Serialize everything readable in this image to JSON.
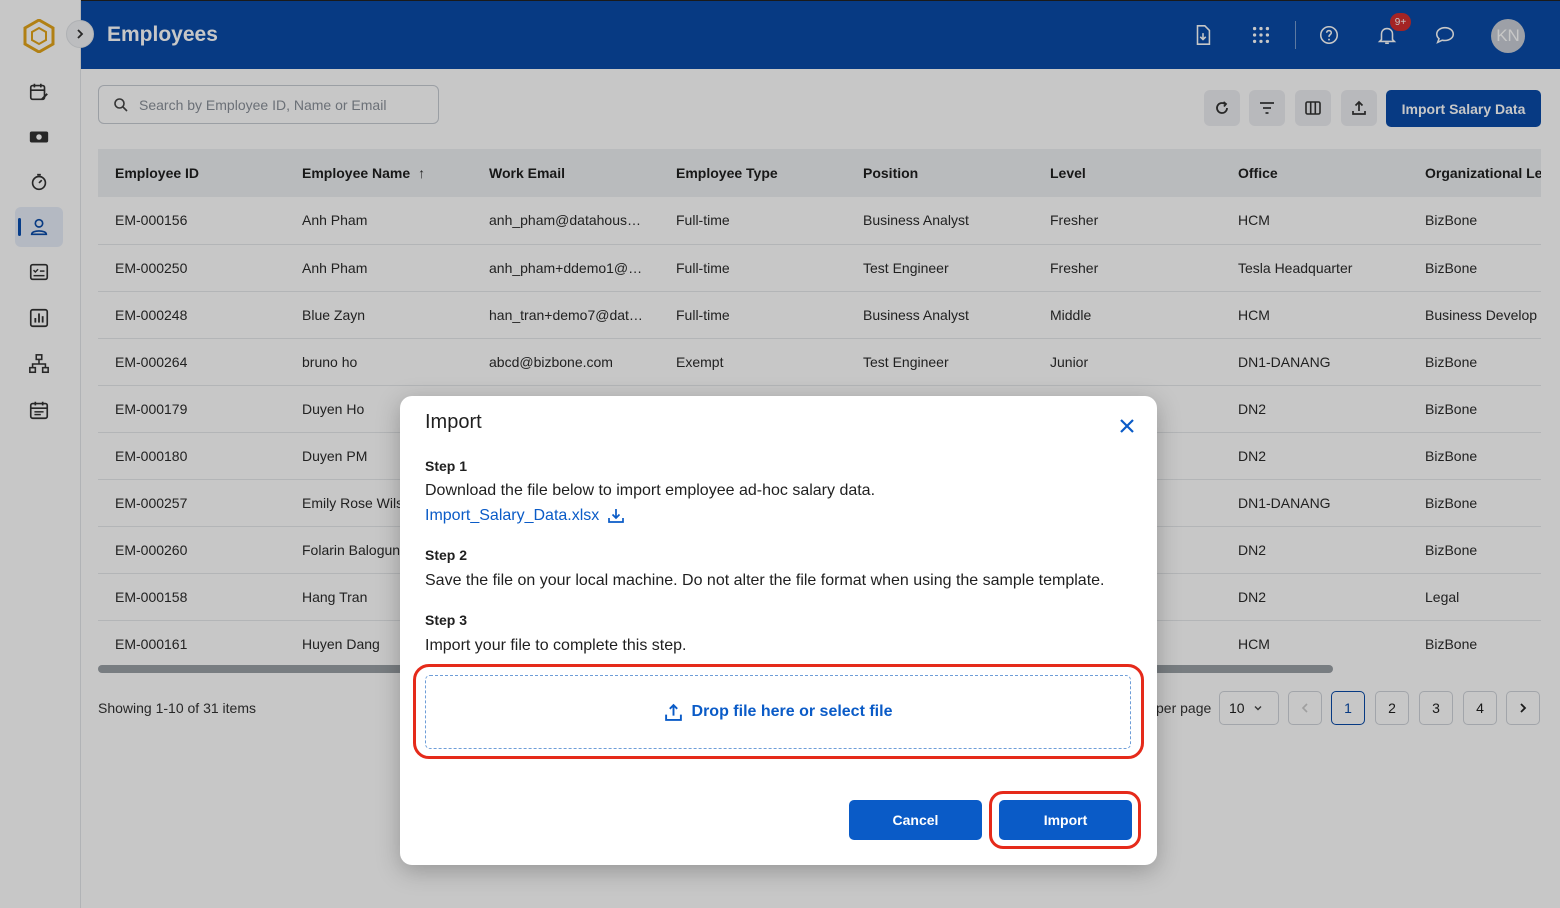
{
  "header": {
    "title": "Employees",
    "notification_badge": "9+",
    "avatar_initials": "KN"
  },
  "sidebar": {
    "items": [
      {
        "name": "timesheet",
        "icon": "calendar-edit-icon"
      },
      {
        "name": "payroll",
        "icon": "money-icon"
      },
      {
        "name": "time-tracking",
        "icon": "timer-icon"
      },
      {
        "name": "employees",
        "icon": "person-icon",
        "active": true
      },
      {
        "name": "reviews",
        "icon": "checklist-icon"
      },
      {
        "name": "reports",
        "icon": "bar-chart-icon"
      },
      {
        "name": "org-chart",
        "icon": "org-chart-icon"
      },
      {
        "name": "calendar",
        "icon": "calendar-icon"
      }
    ]
  },
  "toolbar": {
    "search_placeholder": "Search by Employee ID, Name or Email",
    "import_salary_label": "Import Salary Data"
  },
  "table": {
    "columns": [
      "Employee ID",
      "Employee Name",
      "Work Email",
      "Employee Type",
      "Position",
      "Level",
      "Office",
      "Organizational Le"
    ],
    "rows": [
      [
        "EM-000156",
        "Anh Pham",
        "anh_pham@datahous…",
        "Full-time",
        "Business Analyst",
        "Fresher",
        "HCM",
        "BizBone"
      ],
      [
        "EM-000250",
        "Anh Pham",
        "anh_pham+ddemo1@…",
        "Full-time",
        "Test Engineer",
        "Fresher",
        "Tesla Headquarter",
        "BizBone"
      ],
      [
        "EM-000248",
        "Blue Zayn",
        "han_tran+demo7@dat…",
        "Full-time",
        "Business Analyst",
        "Middle",
        "HCM",
        "Business Develop"
      ],
      [
        "EM-000264",
        "bruno ho",
        "abcd@bizbone.com",
        "Exempt",
        "Test Engineer",
        "Junior",
        "DN1-DANANG",
        "BizBone"
      ],
      [
        "EM-000179",
        "Duyen Ho",
        "",
        "",
        "",
        "",
        "DN2",
        "BizBone"
      ],
      [
        "EM-000180",
        "Duyen PM",
        "",
        "",
        "",
        "",
        "DN2",
        "BizBone"
      ],
      [
        "EM-000257",
        "Emily Rose Wils",
        "",
        "",
        "",
        "",
        "DN1-DANANG",
        "BizBone"
      ],
      [
        "EM-000260",
        "Folarin Balogun",
        "",
        "",
        "",
        "",
        "DN2",
        "BizBone"
      ],
      [
        "EM-000158",
        "Hang Tran",
        "",
        "",
        "",
        "",
        "DN2",
        "Legal"
      ],
      [
        "EM-000161",
        "Huyen Dang",
        "",
        "",
        "",
        "",
        "HCM",
        "BizBone"
      ]
    ]
  },
  "pagination": {
    "showing": "Showing 1-10 of 31 items",
    "per_page_label": "per page",
    "per_page_value": "10",
    "pages": [
      "1",
      "2",
      "3",
      "4"
    ],
    "current_page": "1"
  },
  "modal": {
    "title": "Import",
    "step1_label": "Step 1",
    "step1_text": "Download the file below to import employee ad-hoc salary data.",
    "file_name": "Import_Salary_Data.xlsx",
    "step2_label": "Step 2",
    "step2_text": "Save the file on your local machine. Do not alter the file format when using the sample template.",
    "step3_label": "Step 3",
    "step3_text": "Import your file to complete this step.",
    "dropzone_label": "Drop file here or select file",
    "cancel_label": "Cancel",
    "import_label": "Import"
  },
  "colors": {
    "primary": "#0a4ba8",
    "link": "#0a5bc7",
    "highlight": "#e52a1a"
  }
}
